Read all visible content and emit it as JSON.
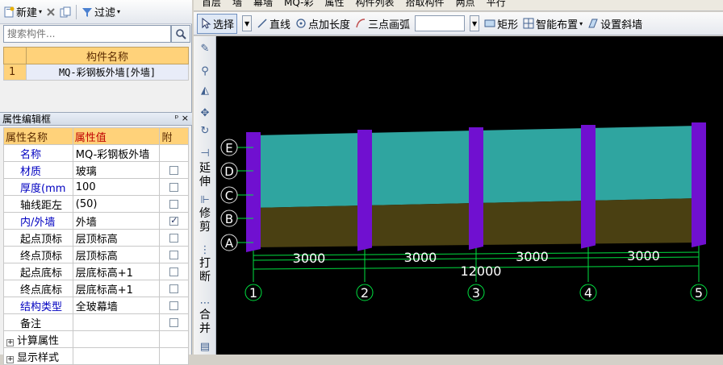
{
  "left_toolbar": {
    "new_label": "新建",
    "filter_label": "过滤"
  },
  "search": {
    "placeholder": "搜索构件..."
  },
  "component_list": {
    "header": "构件名称",
    "rows": [
      {
        "index": "1",
        "name": "MQ-彩钢板外墙[外墙]"
      }
    ]
  },
  "property_panel": {
    "title": "属性编辑框",
    "pin_glyphs": "ᵖ ×",
    "col_name": "属性名称",
    "col_value": "属性值",
    "col_attach": "附",
    "rows": [
      {
        "name": "名称",
        "value": "MQ-彩钢板外墙",
        "check": null,
        "blue": true
      },
      {
        "name": "材质",
        "value": "玻璃",
        "check": false,
        "blue": true
      },
      {
        "name": "厚度(mm",
        "value": "100",
        "check": false,
        "blue": true
      },
      {
        "name": "轴线距左",
        "value": "(50)",
        "check": false,
        "blue": false
      },
      {
        "name": "内/外墙",
        "value": "外墙",
        "check": true,
        "blue": true
      },
      {
        "name": "起点顶标",
        "value": "层顶标高",
        "check": false,
        "blue": false
      },
      {
        "name": "终点顶标",
        "value": "层顶标高",
        "check": false,
        "blue": false
      },
      {
        "name": "起点底标",
        "value": "层底标高+1",
        "check": false,
        "blue": false
      },
      {
        "name": "终点底标",
        "value": "层底标高+1",
        "check": false,
        "blue": false
      },
      {
        "name": "结构类型",
        "value": "全玻幕墙",
        "check": false,
        "blue": true
      },
      {
        "name": "备注",
        "value": "",
        "check": false,
        "blue": false
      }
    ],
    "groups": [
      "计算属性",
      "显示样式"
    ]
  },
  "top_toolbar_cut": {
    "items": [
      "首层",
      "墙",
      "幕墙",
      "MQ-彩",
      "属性",
      "构件列表",
      "拾取构件",
      "两点",
      "平行"
    ]
  },
  "draw_toolbar": {
    "select": "选择",
    "line": "直线",
    "point_length": "点加长度",
    "arc": "三点画弧",
    "rect": "矩形",
    "smart": "智能布置",
    "slope": "设置斜墙"
  },
  "vertical_toolbar": {
    "extend": [
      "延",
      "伸"
    ],
    "trim": [
      "修",
      "剪"
    ],
    "break": [
      "打",
      "断"
    ],
    "merge": [
      "合",
      "并"
    ]
  },
  "drawing": {
    "row_axes": [
      "E",
      "D",
      "C",
      "B",
      "A"
    ],
    "col_axes": [
      "1",
      "2",
      "3",
      "4",
      "5"
    ],
    "spans": [
      "3000",
      "3000",
      "3000",
      "3000"
    ],
    "total": "12000",
    "colors": {
      "glass": "#2fa5a0",
      "lower": "#4a4012",
      "column": "#7010d0",
      "axis": "#00e040"
    }
  }
}
